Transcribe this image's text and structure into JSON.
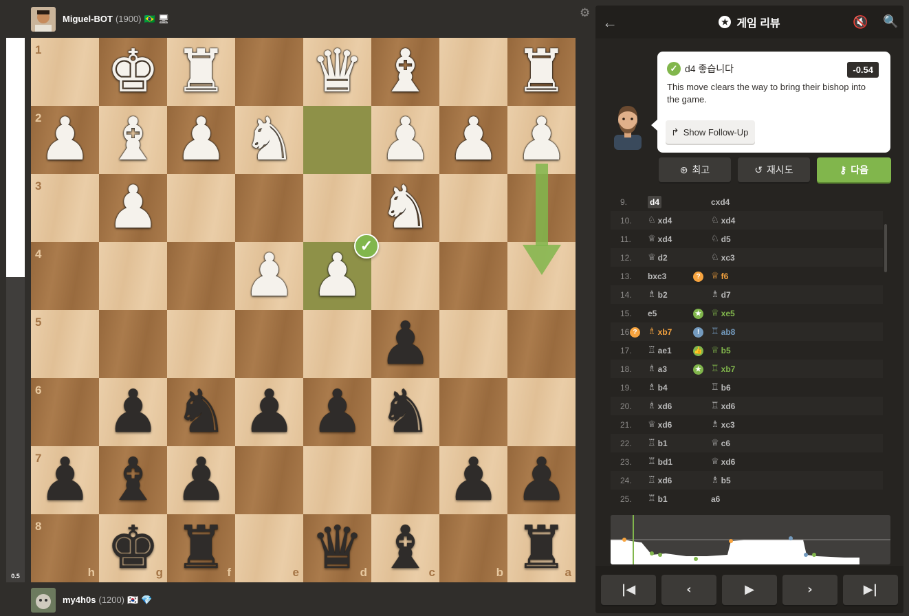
{
  "top_player": {
    "name": "Miguel-BOT",
    "rating": "(1900)",
    "flag": "🇧🇷",
    "badge": "🖥"
  },
  "bottom_player": {
    "name": "my4h0s",
    "rating": "(1200)",
    "flag": "🇰🇷",
    "badge": "💎"
  },
  "eval_bar": {
    "score": "0.5",
    "white_fraction": 0.44
  },
  "board": {
    "ranks": [
      "1",
      "2",
      "3",
      "4",
      "5",
      "6",
      "7",
      "8"
    ],
    "files": [
      "h",
      "g",
      "f",
      "e",
      "d",
      "c",
      "b",
      "a"
    ],
    "highlight_squares": [
      "d2",
      "d4"
    ],
    "pieces": {
      "g1": "w-king",
      "f1": "w-rook",
      "d1": "w-queen",
      "c1": "w-bishop",
      "a1": "w-rook",
      "h2": "w-pawn",
      "g2": "w-bishop",
      "f2": "w-pawn",
      "e2": "w-knight",
      "c2": "w-pawn",
      "b2": "w-pawn",
      "a2": "w-pawn",
      "g3": "w-pawn",
      "c3": "w-knight",
      "e4": "w-pawn",
      "d4": "w-pawn",
      "c5": "b-pawn",
      "g6": "b-pawn",
      "f6": "b-knight",
      "e6": "b-pawn",
      "d6": "b-pawn",
      "c6": "b-knight",
      "h7": "b-pawn",
      "g7": "b-bishop",
      "f7": "b-pawn",
      "b7": "b-pawn",
      "a7": "b-pawn",
      "g8": "b-king",
      "f8": "b-rook",
      "d8": "b-queen",
      "c8": "b-bishop",
      "a8": "b-rook"
    },
    "best_move_arrow": {
      "from": "a2",
      "to": "a4",
      "color": "#81b64c"
    }
  },
  "panel": {
    "title": "게임 리뷰",
    "coach": {
      "move_title": "d4 좋습니다",
      "eval": "-0.54",
      "description": "This move clears the way to bring their bishop into the game.",
      "followup_label": "Show Follow-Up"
    },
    "buttons": {
      "best": "최고",
      "retry": "재시도",
      "next": "다음"
    },
    "moves": [
      {
        "n": "9.",
        "w": {
          "san": "d4",
          "cur": true
        },
        "b": {
          "san": "cxd4"
        }
      },
      {
        "n": "10.",
        "w": {
          "fig": "♘",
          "san": "xd4"
        },
        "b": {
          "fig": "♘",
          "san": "xd4"
        }
      },
      {
        "n": "11.",
        "w": {
          "fig": "♕",
          "san": "xd4"
        },
        "b": {
          "fig": "♘",
          "san": "d5"
        }
      },
      {
        "n": "12.",
        "w": {
          "fig": "♕",
          "san": "d2"
        },
        "b": {
          "fig": "♘",
          "san": "xc3"
        }
      },
      {
        "n": "13.",
        "w": {
          "san": "bxc3"
        },
        "b": {
          "fig": "♕",
          "san": "f6",
          "tag": "?",
          "cls": "orange"
        }
      },
      {
        "n": "14.",
        "w": {
          "fig": "♗",
          "san": "b2"
        },
        "b": {
          "fig": "♗",
          "san": "d7"
        }
      },
      {
        "n": "15.",
        "w": {
          "san": "e5"
        },
        "b": {
          "fig": "♕",
          "san": "xe5",
          "tag": "★",
          "cls": "green-t"
        }
      },
      {
        "n": "16.",
        "w": {
          "fig": "♗",
          "san": "xb7",
          "tag": "?",
          "cls": "orange"
        },
        "b": {
          "fig": "♖",
          "san": "ab8",
          "tag": "!",
          "cls": "blue-t"
        }
      },
      {
        "n": "17.",
        "w": {
          "fig": "♖",
          "san": "ae1"
        },
        "b": {
          "fig": "♕",
          "san": "b5",
          "tag": "👍",
          "cls": "green-t"
        }
      },
      {
        "n": "18.",
        "w": {
          "fig": "♗",
          "san": "a3"
        },
        "b": {
          "fig": "♖",
          "san": "xb7",
          "tag": "★",
          "cls": "green-t"
        }
      },
      {
        "n": "19.",
        "w": {
          "fig": "♗",
          "san": "b4"
        },
        "b": {
          "fig": "♖",
          "san": "b6"
        }
      },
      {
        "n": "20.",
        "w": {
          "fig": "♗",
          "san": "xd6"
        },
        "b": {
          "fig": "♖",
          "san": "xd6"
        }
      },
      {
        "n": "21.",
        "w": {
          "fig": "♕",
          "san": "xd6"
        },
        "b": {
          "fig": "♗",
          "san": "xc3"
        }
      },
      {
        "n": "22.",
        "w": {
          "fig": "♖",
          "san": "b1"
        },
        "b": {
          "fig": "♕",
          "san": "c6"
        }
      },
      {
        "n": "23.",
        "w": {
          "fig": "♖",
          "san": "bd1"
        },
        "b": {
          "fig": "♕",
          "san": "xd6"
        }
      },
      {
        "n": "24.",
        "w": {
          "fig": "♖",
          "san": "xd6"
        },
        "b": {
          "fig": "♗",
          "san": "b5"
        }
      },
      {
        "n": "25.",
        "w": {
          "fig": "♖",
          "san": "b1"
        },
        "b": {
          "san": "a6"
        }
      }
    ],
    "nav": [
      "first",
      "prev",
      "play",
      "next",
      "last"
    ]
  },
  "colors": {
    "accent": "#81b64c",
    "inaccuracy": "#f7a43f",
    "great": "#749bbf",
    "light_square": "#e8c9a0",
    "dark_square": "#a57546"
  }
}
